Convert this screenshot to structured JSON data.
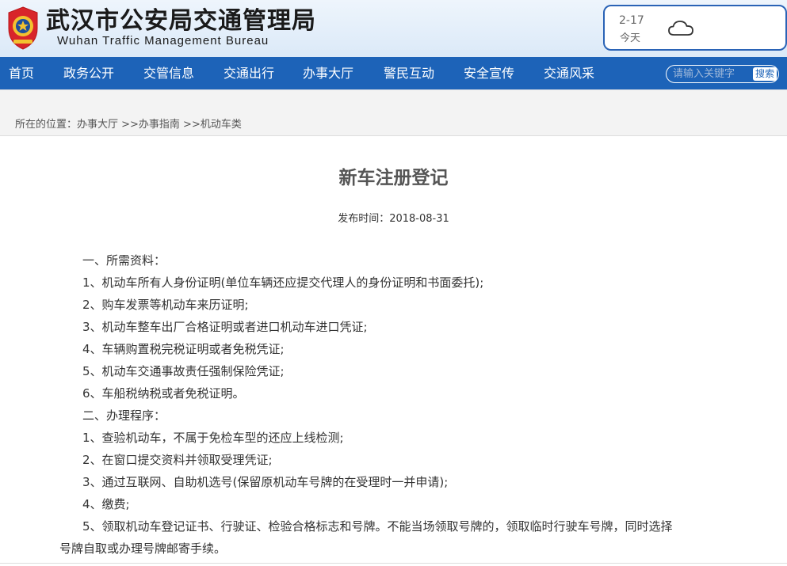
{
  "header": {
    "title": "武汉市公安局交通管理局",
    "subtitle": "Wuhan Traffic Management Bureau"
  },
  "weather": {
    "date": "2-17",
    "day": "今天",
    "icon": "cloud-icon"
  },
  "nav": {
    "items": [
      "首页",
      "政务公开",
      "交管信息",
      "交通出行",
      "办事大厅",
      "警民互动",
      "安全宣传",
      "交通风采"
    ],
    "search_placeholder": "请输入关键字",
    "search_button": "搜索"
  },
  "breadcrumb": "所在的位置：办事大厅 >>办事指南 >>机动车类",
  "article": {
    "title": "新车注册登记",
    "publish_time": "发布时间：2018-08-31",
    "lines": [
      "一、所需资料：",
      "1、机动车所有人身份证明(单位车辆还应提交代理人的身份证明和书面委托);",
      "2、购车发票等机动车来历证明;",
      "3、机动车整车出厂合格证明或者进口机动车进口凭证;",
      "4、车辆购置税完税证明或者免税凭证;",
      "5、机动车交通事故责任强制保险凭证;",
      "6、车船税纳税或者免税证明。",
      "二、办理程序：",
      "1、查验机动车，不属于免检车型的还应上线检测;",
      "2、在窗口提交资料并领取受理凭证;",
      "3、通过互联网、自助机选号(保留原机动车号牌的在受理时一并申请);",
      "4、缴费;",
      "5、领取机动车登记证书、行驶证、检验合格标志和号牌。不能当场领取号牌的，领取临时行驶车号牌，同时选择",
      "号牌自取或办理号牌邮寄手续。"
    ]
  },
  "colors": {
    "nav_bg": "#1d63b8",
    "header_bg": "#dbe9f8",
    "title_text": "#555555"
  }
}
